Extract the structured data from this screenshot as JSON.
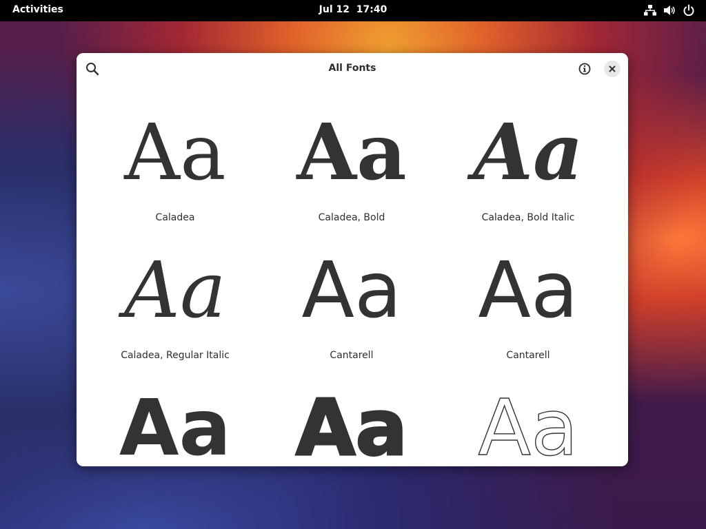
{
  "topbar": {
    "activities_label": "Activities",
    "date": "Jul 12",
    "time": "17:40",
    "icons": [
      "network-icon",
      "volume-icon",
      "power-icon"
    ]
  },
  "window": {
    "title": "All Fonts",
    "header_icons": [
      "search-icon",
      "info-icon",
      "close-icon"
    ]
  },
  "fonts": [
    {
      "sample": "Aa",
      "name": "Caladea"
    },
    {
      "sample": "Aa",
      "name": "Caladea, Bold"
    },
    {
      "sample": "Aa",
      "name": "Caladea, Bold Italic"
    },
    {
      "sample": "Aa",
      "name": "Caladea, Regular Italic"
    },
    {
      "sample": "Aa",
      "name": "Cantarell"
    },
    {
      "sample": "Aa",
      "name": "Cantarell"
    },
    {
      "sample": "Aa",
      "name": ""
    },
    {
      "sample": "Aa",
      "name": ""
    },
    {
      "sample": "Aa",
      "name": ""
    }
  ],
  "colors": {
    "topbar_bg": "#000000",
    "window_bg": "#ffffff",
    "text": "#2e2e2e",
    "sample_text": "#333333"
  }
}
